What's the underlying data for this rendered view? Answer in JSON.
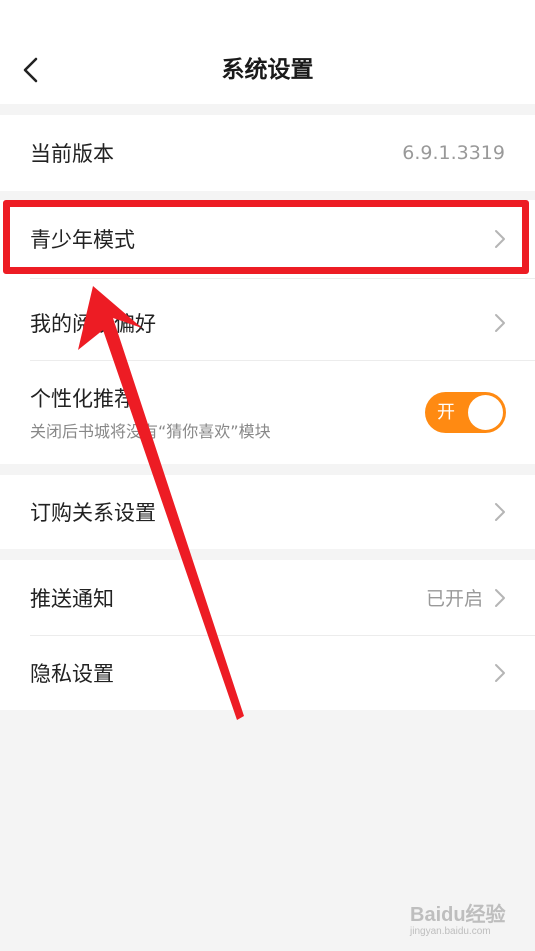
{
  "header": {
    "title": "系统设置"
  },
  "version": {
    "label": "当前版本",
    "value": "6.9.1.3319"
  },
  "teen_mode": {
    "label": "青少年模式"
  },
  "reading_pref": {
    "label": "我的阅读偏好"
  },
  "personalized": {
    "label": "个性化推荐",
    "description": "关闭后书城将没有“猜你喜欢”模块",
    "toggle_text": "开",
    "enabled": true
  },
  "subscription": {
    "label": "订购关系设置"
  },
  "push": {
    "label": "推送通知",
    "value": "已开启"
  },
  "privacy": {
    "label": "隐私设置"
  },
  "colors": {
    "accent": "#ff8a12",
    "annotation": "#ed1c24"
  },
  "watermark": {
    "brand": "Baidu经验",
    "url": "jingyan.baidu.com"
  }
}
